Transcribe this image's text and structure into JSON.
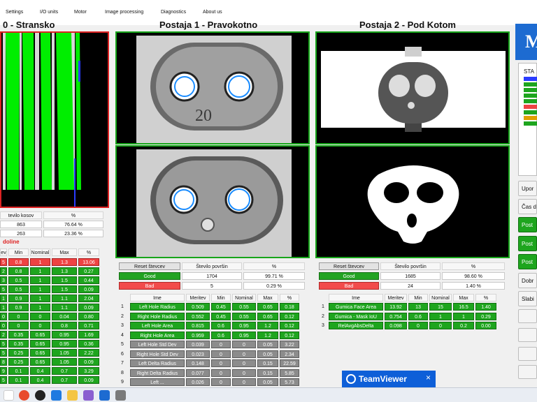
{
  "menu": [
    "Settings",
    "I/O units",
    "Motor",
    "Image processing",
    "Diagnostics",
    "About us"
  ],
  "station0": {
    "title": "0 - Stransko",
    "counter_header": [
      "tevilo kosov",
      "%"
    ],
    "counter_rows": [
      [
        "863",
        "76.64 %"
      ],
      [
        "263",
        "23.36 %"
      ]
    ],
    "status": "doline",
    "table_headers": [
      "ev",
      "Min",
      "Nominal",
      "Max",
      "%"
    ],
    "rows": [
      {
        "c": "r",
        "v": [
          "5",
          "0.8",
          "1",
          "1.3",
          "13.06"
        ]
      },
      {
        "c": "g",
        "v": [
          "2",
          "0.8",
          "1",
          "1.3",
          "0.27"
        ]
      },
      {
        "c": "g",
        "v": [
          "3",
          "0.5",
          "1",
          "1.5",
          "0.44"
        ]
      },
      {
        "c": "g",
        "v": [
          "5",
          "0.5",
          "1",
          "1.5",
          "0.09"
        ]
      },
      {
        "c": "g",
        "v": [
          "1",
          "0.9",
          "1",
          "1.1",
          "2.04"
        ]
      },
      {
        "c": "g",
        "v": [
          "1",
          "0.9",
          "1",
          "1.1",
          "0.09"
        ]
      },
      {
        "c": "g",
        "v": [
          "0",
          "0",
          "0",
          "0.04",
          "0.80"
        ]
      },
      {
        "c": "g",
        "v": [
          "0",
          "0",
          "0",
          "0.8",
          "0.71"
        ]
      },
      {
        "c": "g",
        "v": [
          "2",
          "0.35",
          "0.65",
          "0.95",
          "1.69"
        ]
      },
      {
        "c": "g",
        "v": [
          "5",
          "0.35",
          "0.65",
          "0.95",
          "0.36"
        ]
      },
      {
        "c": "g",
        "v": [
          "5",
          "0.25",
          "0.65",
          "1.05",
          "2.22"
        ]
      },
      {
        "c": "g",
        "v": [
          "8",
          "0.25",
          "0.65",
          "1.05",
          "0.09"
        ]
      },
      {
        "c": "g",
        "v": [
          "9",
          "0.1",
          "0.4",
          "0.7",
          "3.29"
        ]
      },
      {
        "c": "g",
        "v": [
          "5",
          "0.1",
          "0.4",
          "0.7",
          "0.09"
        ]
      }
    ]
  },
  "station1": {
    "title": "Postaja 1 - Pravokotno",
    "reset": "Reset števcev",
    "count_label": "Število površin",
    "pct_label": "%",
    "good": {
      "label": "Good",
      "count": "1704",
      "pct": "99.71 %"
    },
    "bad": {
      "label": "Bad",
      "count": "5",
      "pct": "0.29 %"
    },
    "table_headers": [
      "Ime",
      "Meritev",
      "Min",
      "Nominal",
      "Max",
      "%"
    ],
    "rows": [
      {
        "n": "1",
        "c": "g",
        "v": [
          "Left Hole Radius",
          "0.509",
          "0.45",
          "0.55",
          "0.65",
          "0.18"
        ]
      },
      {
        "n": "2",
        "c": "g",
        "v": [
          "Right Hole Radius",
          "0.552",
          "0.45",
          "0.55",
          "0.65",
          "0.12"
        ]
      },
      {
        "n": "3",
        "c": "g",
        "v": [
          "Left Hole Area",
          "0.815",
          "0.6",
          "0.95",
          "1.2",
          "0.12"
        ]
      },
      {
        "n": "4",
        "c": "g",
        "v": [
          "Right Hole Area",
          "0.959",
          "0.6",
          "0.95",
          "1.2",
          "0.12"
        ]
      },
      {
        "n": "5",
        "c": "gr",
        "v": [
          "Left Hole Std Dev",
          "0.039",
          "0",
          "0",
          "0.05",
          "3.22"
        ]
      },
      {
        "n": "6",
        "c": "gr",
        "v": [
          "Right Hole Std Dev",
          "0.023",
          "0",
          "0",
          "0.05",
          "2.34"
        ]
      },
      {
        "n": "7",
        "c": "gr",
        "v": [
          "Left Delta Radius",
          "0.148",
          "0",
          "0",
          "0.15",
          "22.59"
        ]
      },
      {
        "n": "8",
        "c": "gr",
        "v": [
          "Right Delta Radius",
          "0.077",
          "0",
          "0",
          "0.15",
          "5.85"
        ]
      },
      {
        "n": "9",
        "c": "gr",
        "v": [
          "Left ...",
          "0.026",
          "0",
          "0",
          "0.05",
          "5.73"
        ]
      }
    ],
    "stamp": "20"
  },
  "station2": {
    "title": "Postaja 2 - Pod Kotom",
    "reset": "Reset števcev",
    "count_label": "Število površin",
    "pct_label": "%",
    "good": {
      "label": "Good",
      "count": "1685",
      "pct": "98.60 %"
    },
    "bad": {
      "label": "Bad",
      "count": "24",
      "pct": "1.40 %"
    },
    "table_headers": [
      "Ime",
      "Meritev",
      "Min",
      "Nominal",
      "Max",
      "%"
    ],
    "rows": [
      {
        "n": "1",
        "c": "g",
        "v": [
          "Gumica Face Area",
          "13.92",
          "13",
          "15",
          "16.5",
          "1.40"
        ]
      },
      {
        "n": "2",
        "c": "g",
        "v": [
          "Gumica - Mask IoU",
          "0.754",
          "0.6",
          "1",
          "1",
          "0.29"
        ]
      },
      {
        "n": "3",
        "c": "g",
        "v": [
          "RelAvgAbsDelta",
          "0.098",
          "0",
          "0",
          "0.2",
          "0.00"
        ]
      }
    ]
  },
  "right_panel": {
    "logo": "M",
    "status_label": "STA",
    "buttons": [
      "Upor",
      "Čas d",
      "Post",
      "Post",
      "Post",
      "Dobr",
      "Slabi"
    ]
  },
  "teamviewer": {
    "label": "TeamViewer",
    "close": "×"
  },
  "colors": {
    "good": "#1ea51e",
    "bad": "#ef4343",
    "frame": "#17a51a",
    "teamviewer": "#0e5fd8"
  }
}
